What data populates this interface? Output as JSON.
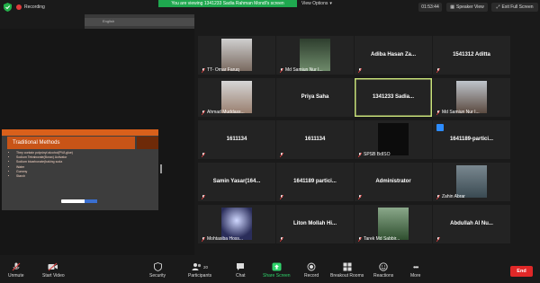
{
  "top": {
    "recording_label": "Recording",
    "banner_text": "You are viewing 1341233 Sadia Rahman Mondl's screen",
    "view_options_label": "View Options",
    "timer": "01:53:44",
    "speaker_view_label": "Speaker View",
    "exit_fullscreen_label": "Exit Full Screen"
  },
  "share": {
    "toolbar_label": "English",
    "slide_title": "Traditional Methods",
    "slide_bullets": [
      "They contain polyvinyl alcohol(PVA glue)",
      "Sodium Tetraborate(Borax) Activator",
      "Sodium bicarbonate(baking soda",
      "Water",
      "Gummy",
      "Starch"
    ]
  },
  "participants": [
    {
      "name": "TT- Omar Faruq",
      "variant": "photo",
      "photo": "a",
      "muted": true
    },
    {
      "name": "Md Samiun Nur I...",
      "variant": "photo",
      "photo": "b",
      "muted": true
    },
    {
      "name": "Adiba Hasan Za...",
      "variant": "text",
      "muted": true
    },
    {
      "name": "1541312 Aditta",
      "variant": "text",
      "muted": true
    },
    {
      "name": "Ahmad Muddass...",
      "variant": "photo",
      "photo": "c",
      "muted": true
    },
    {
      "name": "Priya Saha",
      "variant": "text",
      "muted": false
    },
    {
      "name": "1341233 Sadia...",
      "variant": "text",
      "muted": false,
      "highlight": true
    },
    {
      "name": "Md Samiun Nur I...",
      "variant": "photo",
      "photo": "d",
      "muted": true
    },
    {
      "name": "1611134",
      "variant": "text",
      "muted": true
    },
    {
      "name": "1611134",
      "variant": "text",
      "muted": true
    },
    {
      "name": "SPSB BdISO",
      "variant": "photo",
      "photo": "e",
      "muted": true
    },
    {
      "name": "1641189-partici...",
      "variant": "text",
      "muted": false,
      "blueicon": true
    },
    {
      "name": "Samin Yasar(164...",
      "variant": "text",
      "muted": true
    },
    {
      "name": "1641189 partici...",
      "variant": "text",
      "muted": true
    },
    {
      "name": "Administrator",
      "variant": "text",
      "muted": true
    },
    {
      "name": "Zahin Abrar",
      "variant": "photo",
      "photo": "f",
      "muted": true
    },
    {
      "name": "Mohtasiba Hoss...",
      "variant": "photo",
      "photo": "g",
      "muted": true
    },
    {
      "name": "Liton Mollah Hi...",
      "variant": "text",
      "muted": true
    },
    {
      "name": "Tarek Md Sabbir...",
      "variant": "photo",
      "photo": "h",
      "muted": true
    },
    {
      "name": "Abdullah Al Nu...",
      "variant": "text",
      "muted": true
    }
  ],
  "toolbar": {
    "unmute": "Unmute",
    "start_video": "Start Video",
    "security": "Security",
    "participants": "Participants",
    "participants_count": "20",
    "chat": "Chat",
    "share_screen": "Share Screen",
    "record": "Record",
    "breakout": "Breakout Rooms",
    "reactions": "Reactions",
    "more": "More",
    "end": "End"
  }
}
